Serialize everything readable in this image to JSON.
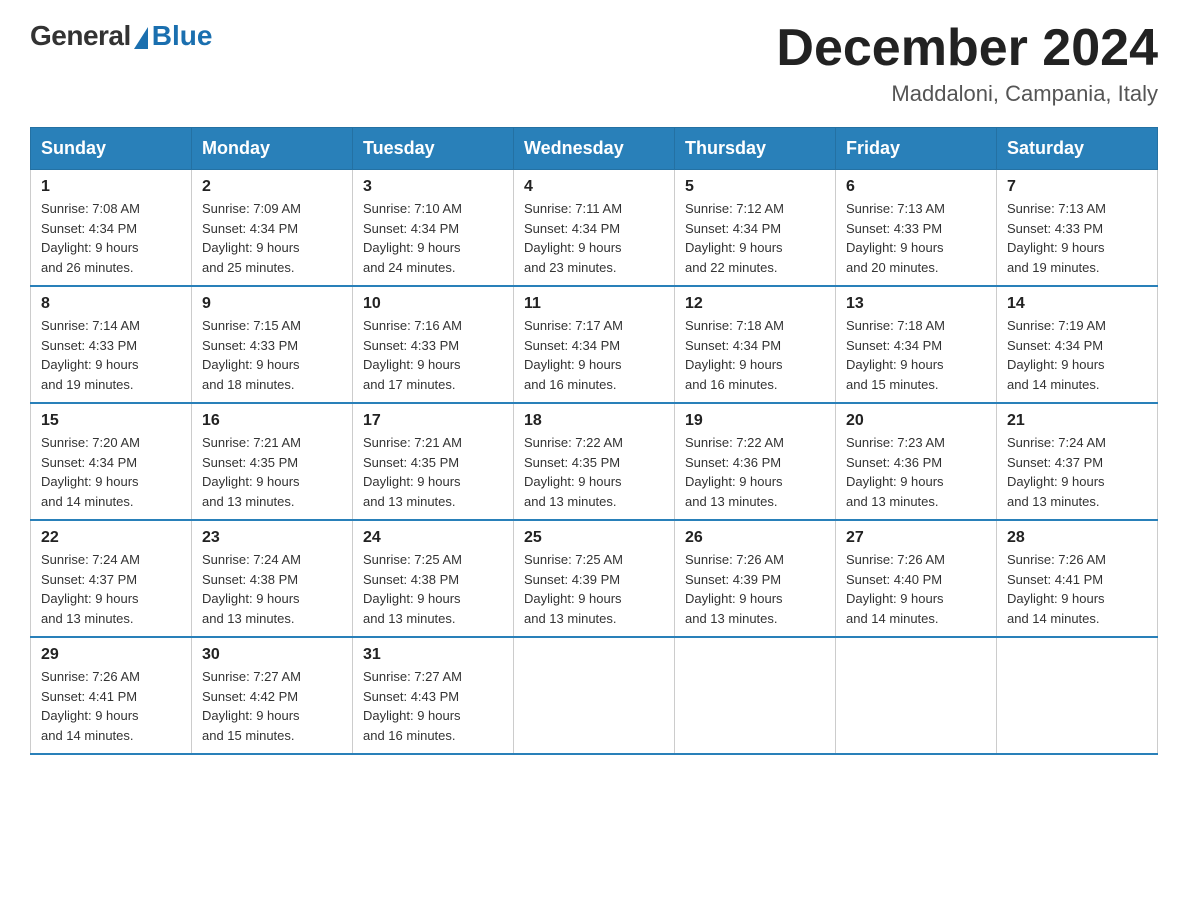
{
  "header": {
    "logo_general": "General",
    "logo_blue": "Blue",
    "month_title": "December 2024",
    "location": "Maddaloni, Campania, Italy"
  },
  "days_of_week": [
    "Sunday",
    "Monday",
    "Tuesday",
    "Wednesday",
    "Thursday",
    "Friday",
    "Saturday"
  ],
  "weeks": [
    [
      {
        "day": "1",
        "sunrise": "7:08 AM",
        "sunset": "4:34 PM",
        "daylight": "9 hours and 26 minutes."
      },
      {
        "day": "2",
        "sunrise": "7:09 AM",
        "sunset": "4:34 PM",
        "daylight": "9 hours and 25 minutes."
      },
      {
        "day": "3",
        "sunrise": "7:10 AM",
        "sunset": "4:34 PM",
        "daylight": "9 hours and 24 minutes."
      },
      {
        "day": "4",
        "sunrise": "7:11 AM",
        "sunset": "4:34 PM",
        "daylight": "9 hours and 23 minutes."
      },
      {
        "day": "5",
        "sunrise": "7:12 AM",
        "sunset": "4:34 PM",
        "daylight": "9 hours and 22 minutes."
      },
      {
        "day": "6",
        "sunrise": "7:13 AM",
        "sunset": "4:33 PM",
        "daylight": "9 hours and 20 minutes."
      },
      {
        "day": "7",
        "sunrise": "7:13 AM",
        "sunset": "4:33 PM",
        "daylight": "9 hours and 19 minutes."
      }
    ],
    [
      {
        "day": "8",
        "sunrise": "7:14 AM",
        "sunset": "4:33 PM",
        "daylight": "9 hours and 19 minutes."
      },
      {
        "day": "9",
        "sunrise": "7:15 AM",
        "sunset": "4:33 PM",
        "daylight": "9 hours and 18 minutes."
      },
      {
        "day": "10",
        "sunrise": "7:16 AM",
        "sunset": "4:33 PM",
        "daylight": "9 hours and 17 minutes."
      },
      {
        "day": "11",
        "sunrise": "7:17 AM",
        "sunset": "4:34 PM",
        "daylight": "9 hours and 16 minutes."
      },
      {
        "day": "12",
        "sunrise": "7:18 AM",
        "sunset": "4:34 PM",
        "daylight": "9 hours and 16 minutes."
      },
      {
        "day": "13",
        "sunrise": "7:18 AM",
        "sunset": "4:34 PM",
        "daylight": "9 hours and 15 minutes."
      },
      {
        "day": "14",
        "sunrise": "7:19 AM",
        "sunset": "4:34 PM",
        "daylight": "9 hours and 14 minutes."
      }
    ],
    [
      {
        "day": "15",
        "sunrise": "7:20 AM",
        "sunset": "4:34 PM",
        "daylight": "9 hours and 14 minutes."
      },
      {
        "day": "16",
        "sunrise": "7:21 AM",
        "sunset": "4:35 PM",
        "daylight": "9 hours and 13 minutes."
      },
      {
        "day": "17",
        "sunrise": "7:21 AM",
        "sunset": "4:35 PM",
        "daylight": "9 hours and 13 minutes."
      },
      {
        "day": "18",
        "sunrise": "7:22 AM",
        "sunset": "4:35 PM",
        "daylight": "9 hours and 13 minutes."
      },
      {
        "day": "19",
        "sunrise": "7:22 AM",
        "sunset": "4:36 PM",
        "daylight": "9 hours and 13 minutes."
      },
      {
        "day": "20",
        "sunrise": "7:23 AM",
        "sunset": "4:36 PM",
        "daylight": "9 hours and 13 minutes."
      },
      {
        "day": "21",
        "sunrise": "7:24 AM",
        "sunset": "4:37 PM",
        "daylight": "9 hours and 13 minutes."
      }
    ],
    [
      {
        "day": "22",
        "sunrise": "7:24 AM",
        "sunset": "4:37 PM",
        "daylight": "9 hours and 13 minutes."
      },
      {
        "day": "23",
        "sunrise": "7:24 AM",
        "sunset": "4:38 PM",
        "daylight": "9 hours and 13 minutes."
      },
      {
        "day": "24",
        "sunrise": "7:25 AM",
        "sunset": "4:38 PM",
        "daylight": "9 hours and 13 minutes."
      },
      {
        "day": "25",
        "sunrise": "7:25 AM",
        "sunset": "4:39 PM",
        "daylight": "9 hours and 13 minutes."
      },
      {
        "day": "26",
        "sunrise": "7:26 AM",
        "sunset": "4:39 PM",
        "daylight": "9 hours and 13 minutes."
      },
      {
        "day": "27",
        "sunrise": "7:26 AM",
        "sunset": "4:40 PM",
        "daylight": "9 hours and 14 minutes."
      },
      {
        "day": "28",
        "sunrise": "7:26 AM",
        "sunset": "4:41 PM",
        "daylight": "9 hours and 14 minutes."
      }
    ],
    [
      {
        "day": "29",
        "sunrise": "7:26 AM",
        "sunset": "4:41 PM",
        "daylight": "9 hours and 14 minutes."
      },
      {
        "day": "30",
        "sunrise": "7:27 AM",
        "sunset": "4:42 PM",
        "daylight": "9 hours and 15 minutes."
      },
      {
        "day": "31",
        "sunrise": "7:27 AM",
        "sunset": "4:43 PM",
        "daylight": "9 hours and 16 minutes."
      },
      null,
      null,
      null,
      null
    ]
  ],
  "labels": {
    "sunrise_prefix": "Sunrise: ",
    "sunset_prefix": "Sunset: ",
    "daylight_prefix": "Daylight: "
  }
}
